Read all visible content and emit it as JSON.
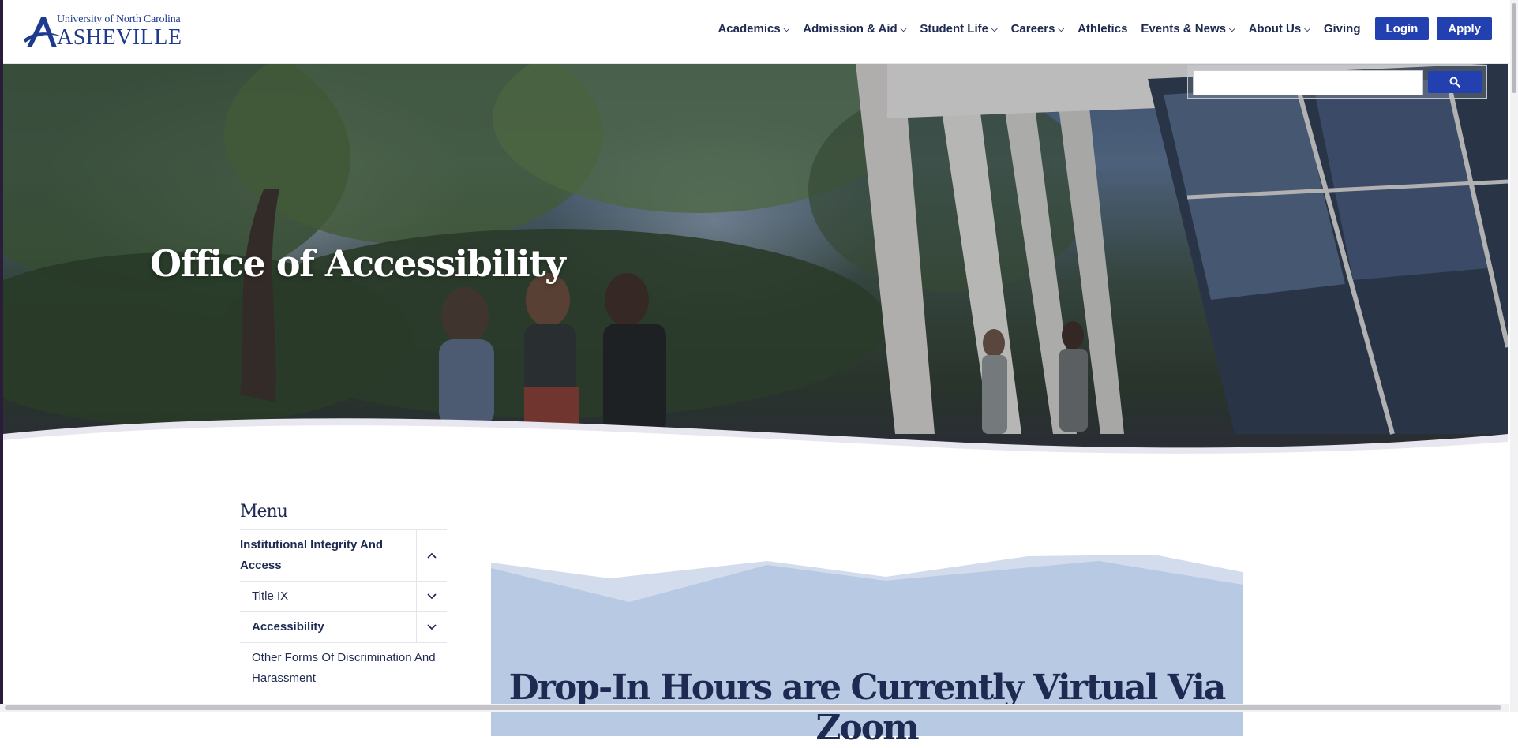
{
  "logo": {
    "line1": "University of North Carolina",
    "line2": "ASHEVILLE"
  },
  "nav": {
    "items": [
      {
        "label": "Academics",
        "has_dropdown": true
      },
      {
        "label": "Admission & Aid",
        "has_dropdown": true
      },
      {
        "label": "Student Life",
        "has_dropdown": true
      },
      {
        "label": "Careers",
        "has_dropdown": true
      },
      {
        "label": "Athletics",
        "has_dropdown": false
      },
      {
        "label": "Events & News",
        "has_dropdown": true
      },
      {
        "label": "About Us",
        "has_dropdown": true
      },
      {
        "label": "Giving",
        "has_dropdown": false
      }
    ],
    "login_label": "Login",
    "apply_label": "Apply"
  },
  "search": {
    "placeholder": "",
    "icon": "search-icon"
  },
  "hero": {
    "title": "Office of Accessibility"
  },
  "sidebar": {
    "title": "Menu",
    "items": [
      {
        "label": "Institutional Integrity And Access",
        "bold": true,
        "toggle": "chevron-up"
      },
      {
        "label": "Title IX",
        "bold": false,
        "toggle": "chevron-down"
      },
      {
        "label": "Accessibility",
        "bold": true,
        "toggle": "chevron-down"
      },
      {
        "label": "Other Forms Of Discrimination And Harassment",
        "bold": false,
        "toggle": ""
      }
    ]
  },
  "banner": {
    "title": "Drop-In Hours are Currently Virtual Via Zoom"
  },
  "colors": {
    "brand_blue": "#2340b0",
    "navy_text": "#1f2a52",
    "banner_bg": "#b7c9e3",
    "banner_light": "#d2dcec"
  }
}
